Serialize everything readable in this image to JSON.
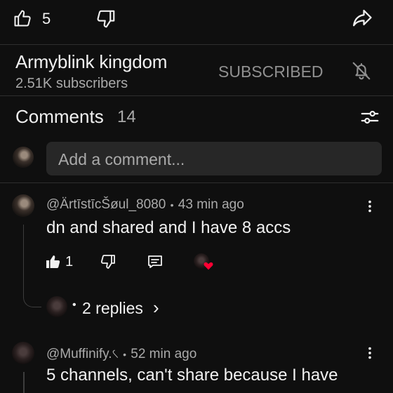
{
  "action_bar": {
    "like_count": "5"
  },
  "channel": {
    "name": "Armyblink kingdom",
    "subscribers": "2.51K subscribers",
    "subscribe_label": "SUBSCRIBED"
  },
  "comments_header": {
    "title": "Comments",
    "count": "14"
  },
  "add_comment": {
    "placeholder": "Add a comment..."
  },
  "comments": [
    {
      "author": "@ÄrtīstīcŠøul_8080",
      "separator": "•",
      "time": "43 min ago",
      "text": "dn and shared and I have 8 accs",
      "likes": "1",
      "replies_label": "2 replies",
      "replies_prefix": "•",
      "replies_chevron": "›"
    },
    {
      "author": "@Muffinify.৻",
      "separator": "•",
      "time": "52 min ago",
      "text": "5 channels, can't share because I have"
    }
  ],
  "colors": {
    "background": "#0f0f0f",
    "text": "#f1f1f1",
    "muted": "#aaaaaa",
    "input_bg": "#272727",
    "heart": "#ff0033"
  },
  "icons": [
    "like-icon",
    "dislike-icon",
    "share-icon",
    "notification-off-icon",
    "filter-icon",
    "more-vert-icon",
    "reply-icon",
    "heart-icon"
  ]
}
